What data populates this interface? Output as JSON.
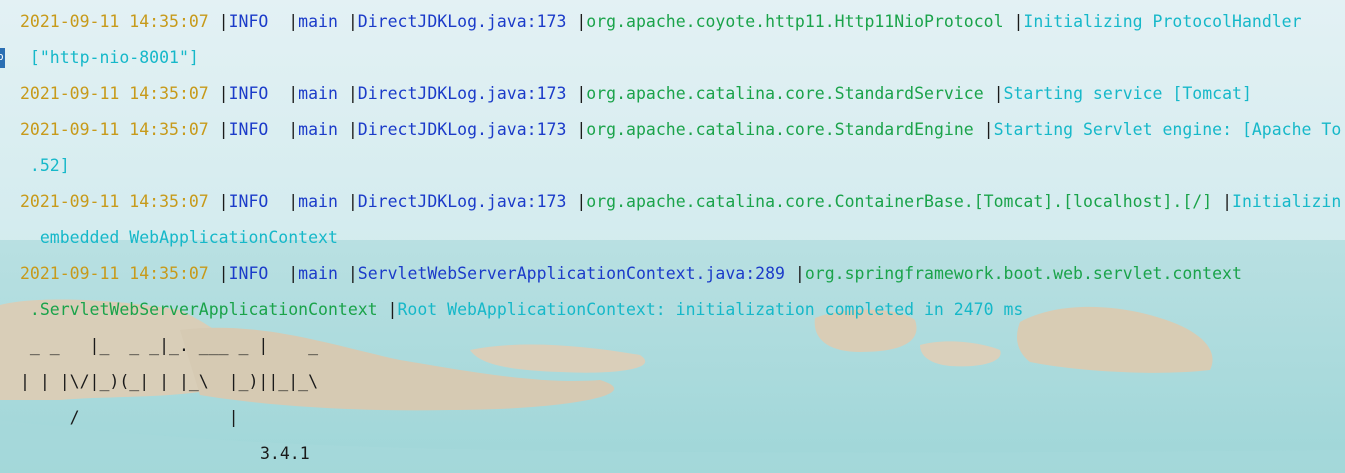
{
  "log": [
    {
      "timestamp": "2021-09-11 14:35:07",
      "level": "INFO ",
      "thread": "main",
      "source": "DirectJDKLog.java:173",
      "logger": "org.apache.coyote.http11.Http11NioProtocol",
      "message": "Initializing ProtocolHandler",
      "continuation": " [\"http-nio-8001\"]"
    },
    {
      "timestamp": "2021-09-11 14:35:07",
      "level": "INFO ",
      "thread": "main",
      "source": "DirectJDKLog.java:173",
      "logger": "org.apache.catalina.core.StandardService",
      "message": "Starting service [Tomcat]"
    },
    {
      "timestamp": "2021-09-11 14:35:07",
      "level": "INFO ",
      "thread": "main",
      "source": "DirectJDKLog.java:173",
      "logger": "org.apache.catalina.core.StandardEngine",
      "message": "Starting Servlet engine: [Apache To",
      "continuation": " .52]"
    },
    {
      "timestamp": "2021-09-11 14:35:07",
      "level": "INFO ",
      "thread": "main",
      "source": "DirectJDKLog.java:173",
      "logger": "org.apache.catalina.core.ContainerBase.[Tomcat].[localhost].[/]",
      "message": "Initializin",
      "continuation": "  embedded WebApplicationContext"
    },
    {
      "timestamp": "2021-09-11 14:35:07",
      "level": "INFO ",
      "thread": "main",
      "source": "ServletWebServerApplicationContext.java:289",
      "logger": "org.springframework.boot.web.servlet.context",
      "logger_continuation": " .ServletWebServerApplicationContext",
      "message": "Root WebApplicationContext: initialization completed in 2470 ms"
    }
  ],
  "banner": {
    "art_line_1": " _ _   |_  _ _|_. ___ _ |    _ ",
    "art_line_2": "| | |\\/|_)(_| | |_\\  |_)||_|_\\ ",
    "art_line_3": "     /               |         ",
    "version": "3.4.1"
  },
  "gutter_marker": "p"
}
